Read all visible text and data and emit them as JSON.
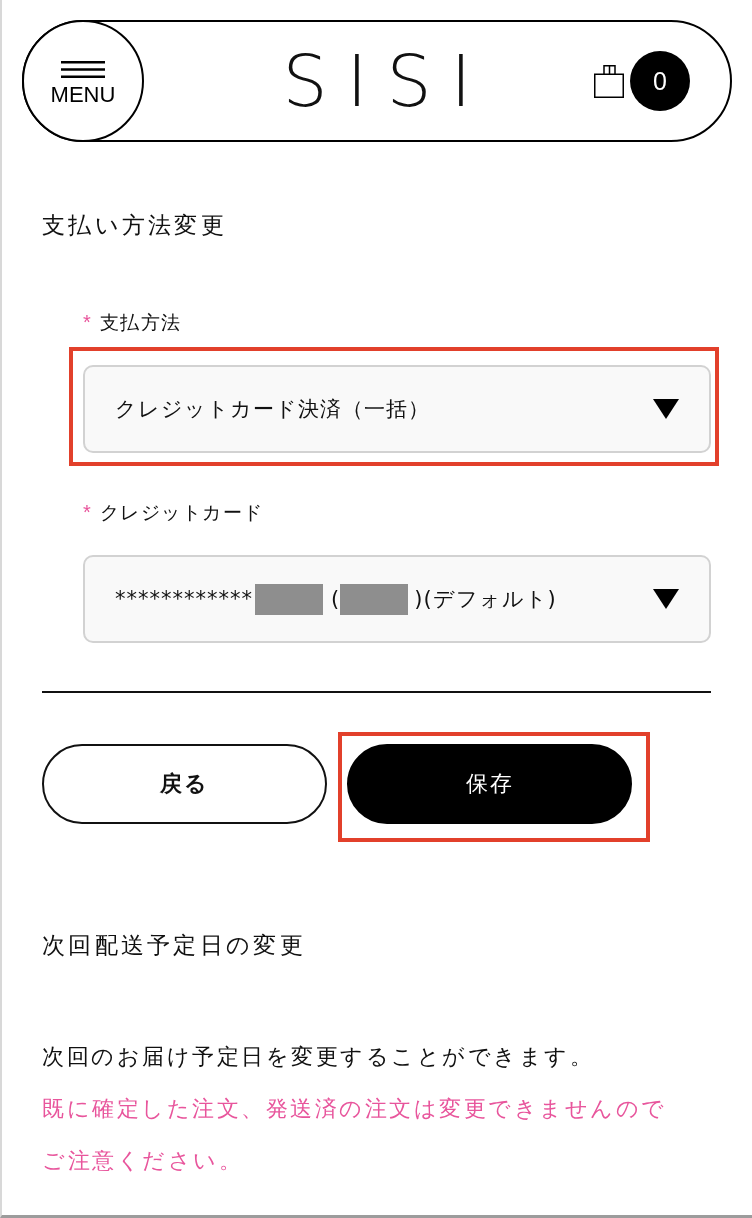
{
  "header": {
    "menu_label": "MENU",
    "logo": "SISI",
    "cart_count": "0"
  },
  "payment_section": {
    "title": "支払い方法変更",
    "fields": [
      {
        "required_mark": "*",
        "label": "支払方法",
        "highlighted": true,
        "value_parts": [
          {
            "kind": "text",
            "text": "クレジットカード決済（一括）"
          }
        ]
      },
      {
        "required_mark": "*",
        "label": "クレジットカード",
        "highlighted": false,
        "value_parts": [
          {
            "kind": "text",
            "text": "************"
          },
          {
            "kind": "redacted"
          },
          {
            "kind": "text",
            "text": "("
          },
          {
            "kind": "redacted"
          },
          {
            "kind": "text",
            "text": ")(デフォルト)"
          }
        ]
      }
    ]
  },
  "buttons": [
    {
      "label": "戻る",
      "kind": "secondary",
      "highlighted": false
    },
    {
      "label": "保存",
      "kind": "primary",
      "highlighted": true
    }
  ],
  "delivery_section": {
    "title": "次回配送予定日の変更",
    "paragraphs": [
      {
        "kind": "normal",
        "text": "次回のお届け予定日を変更することができます。"
      },
      {
        "kind": "warning",
        "text": "既に確定した注文、発送済の注文は変更できませんのでご注意ください。"
      }
    ]
  }
}
